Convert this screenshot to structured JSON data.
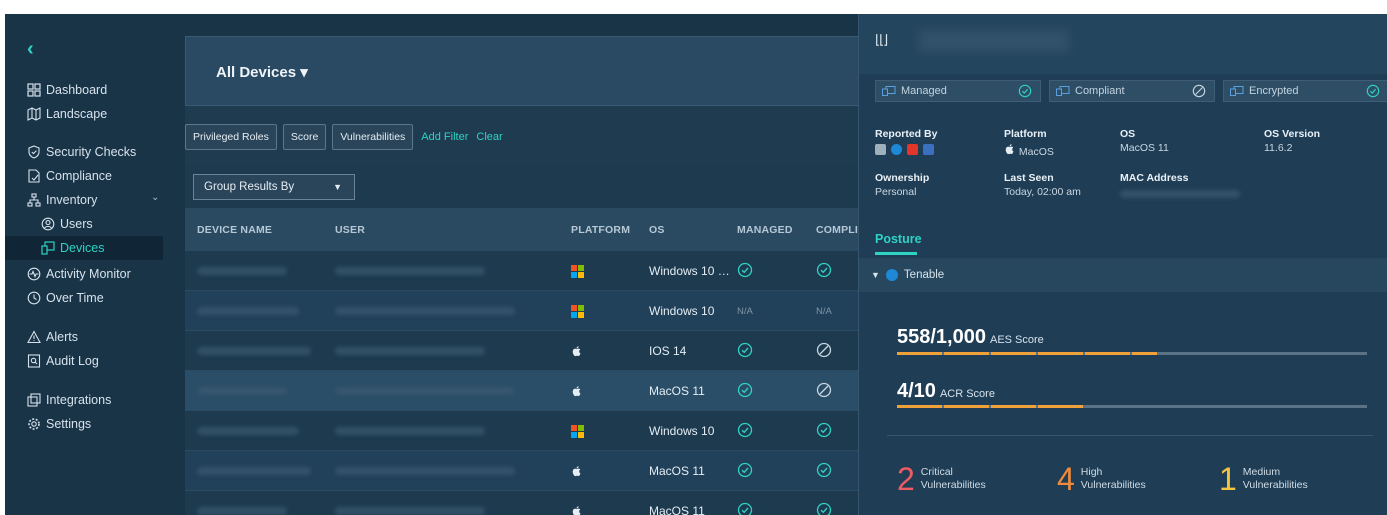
{
  "sidebar": {
    "back": "‹",
    "items": [
      {
        "label": "Dashboard",
        "icon": "dashboard-icon"
      },
      {
        "label": "Landscape",
        "icon": "map-icon"
      },
      {
        "label": "Security Checks",
        "icon": "shield-icon"
      },
      {
        "label": "Compliance",
        "icon": "document-check-icon"
      },
      {
        "label": "Inventory",
        "icon": "hierarchy-icon"
      },
      {
        "label": "Users",
        "icon": "users-icon"
      },
      {
        "label": "Devices",
        "icon": "devices-icon"
      },
      {
        "label": "Activity Monitor",
        "icon": "pulse-icon"
      },
      {
        "label": "Over Time",
        "icon": "clock-icon"
      },
      {
        "label": "Alerts",
        "icon": "warning-icon"
      },
      {
        "label": "Audit Log",
        "icon": "search-log-icon"
      },
      {
        "label": "Integrations",
        "icon": "layers-icon"
      },
      {
        "label": "Settings",
        "icon": "gear-icon"
      }
    ],
    "inventory_chevron": "⌄"
  },
  "main": {
    "title": "All Devices ▾",
    "filters": [
      "Privileged Roles",
      "Score",
      "Vulnerabilities"
    ],
    "add_filter": "Add Filter",
    "clear": "Clear",
    "group_by": "Group Results By",
    "columns": [
      "DEVICE NAME",
      "USER",
      "PLATFORM",
      "OS",
      "MANAGED",
      "COMPLIA"
    ],
    "rows": [
      {
        "platform": "windows",
        "os": "Windows 10 …",
        "managed": "check",
        "compliant": "check"
      },
      {
        "platform": "windows",
        "os": "Windows 10",
        "managed": "N/A",
        "compliant": "N/A"
      },
      {
        "platform": "apple",
        "os": "IOS 14",
        "managed": "check",
        "compliant": "slash"
      },
      {
        "platform": "apple",
        "os": "MacOS 11",
        "managed": "check",
        "compliant": "slash"
      },
      {
        "platform": "windows",
        "os": "Windows 10",
        "managed": "check",
        "compliant": "check"
      },
      {
        "platform": "apple",
        "os": "MacOS 11",
        "managed": "check",
        "compliant": "check"
      },
      {
        "platform": "apple",
        "os": "MacOS 11",
        "managed": "check",
        "compliant": "check"
      }
    ]
  },
  "panel": {
    "logo": "⌊⌊⌋",
    "badges": [
      {
        "label": "Managed",
        "status": "check"
      },
      {
        "label": "Compliant",
        "status": "slash"
      },
      {
        "label": "Encrypted",
        "status": "check"
      }
    ],
    "reported_by_label": "Reported By",
    "platform_label": "Platform",
    "platform_value": "MacOS",
    "os_label": "OS",
    "os_value": "MacOS 11",
    "os_version_label": "OS Version",
    "os_version_value": "11.6.2",
    "ownership_label": "Ownership",
    "ownership_value": "Personal",
    "last_seen_label": "Last Seen",
    "last_seen_value": "Today, 02:00 am",
    "mac_label": "MAC Address",
    "tab": "Posture",
    "source": "Tenable",
    "aes_value": "558/1,000",
    "aes_label": "AES Score",
    "aes_fraction": 0.558,
    "acr_value": "4/10",
    "acr_label": "ACR Score",
    "acr_fraction": 0.4,
    "vulns": [
      {
        "count": "2",
        "line1": "Critical",
        "line2": "Vulnerabilities",
        "color": "#ef5a63"
      },
      {
        "count": "4",
        "line1": "High",
        "line2": "Vulnerabilities",
        "color": "#f08a3c"
      },
      {
        "count": "1",
        "line1": "Medium",
        "line2": "Vulnerabilities",
        "color": "#f5c542"
      }
    ]
  },
  "colors": {
    "accent": "#2ed3c4",
    "score_bar": "#f0a13a"
  }
}
